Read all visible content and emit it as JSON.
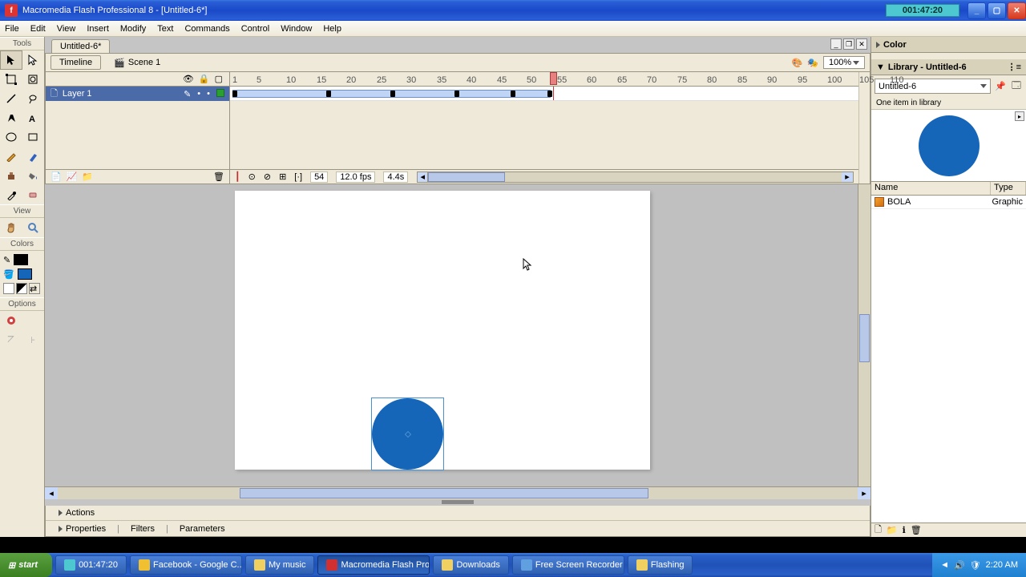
{
  "title": "Macromedia Flash Professional 8 - [Untitled-6*]",
  "timer": "001:47:20",
  "menu": {
    "file": "File",
    "edit": "Edit",
    "view": "View",
    "insert": "Insert",
    "modify": "Modify",
    "text": "Text",
    "commands": "Commands",
    "control": "Control",
    "window": "Window",
    "help": "Help"
  },
  "tools": {
    "header": "Tools",
    "view": "View",
    "colors": "Colors",
    "options": "Options"
  },
  "doc": {
    "tab": "Untitled-6*",
    "timeline": "Timeline",
    "scene": "Scene 1",
    "zoom": "100%"
  },
  "layer": {
    "name": "Layer 1"
  },
  "timeline_ruler": [
    "1",
    "5",
    "10",
    "15",
    "20",
    "25",
    "30",
    "35",
    "40",
    "45",
    "50",
    "55",
    "60",
    "65",
    "70",
    "75",
    "80",
    "85",
    "90",
    "95",
    "100",
    "105",
    "110"
  ],
  "status": {
    "frame": "54",
    "fps": "12.0 fps",
    "time": "4.4s"
  },
  "panels": {
    "color": "Color",
    "library": "Library - Untitled-6",
    "libdoc": "Untitled-6",
    "libcount": "One item in library",
    "col_name": "Name",
    "col_type": "Type",
    "item_name": "BOLA",
    "item_type": "Graphic"
  },
  "bottom": {
    "actions": "Actions",
    "properties": "Properties",
    "filters": "Filters",
    "parameters": "Parameters"
  },
  "taskbar": {
    "start": "start",
    "t1": "001:47:20",
    "t2": "Facebook - Google C...",
    "t3": "My music",
    "t4": "Macromedia Flash Pro...",
    "t5": "Downloads",
    "t6": "Free Screen Recorder",
    "t7": "Flashing",
    "clock": "2:20 AM"
  }
}
